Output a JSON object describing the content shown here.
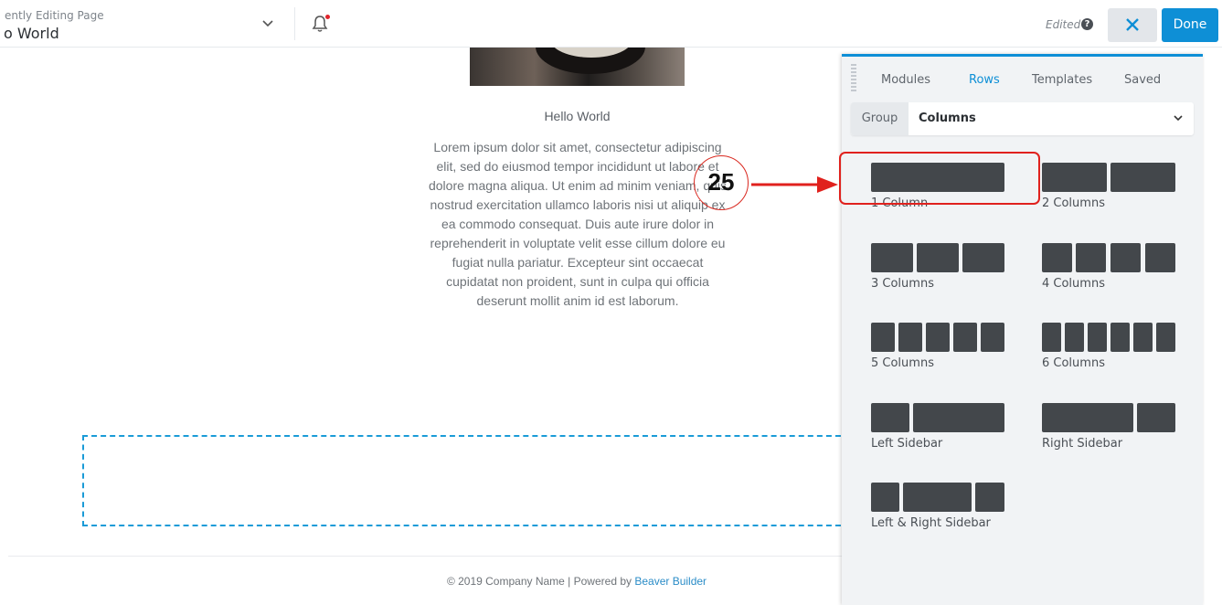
{
  "header": {
    "subtitle": "ently Editing Page",
    "title": "o World",
    "edited_label": "Edited",
    "help_glyph": "?",
    "done_label": "Done",
    "colors": {
      "accent": "#0e8fd6",
      "notification_dot": "#e0242b"
    }
  },
  "content": {
    "heading": "Hello World",
    "body": "Lorem ipsum dolor sit amet, consectetur adipiscing elit, sed do eiusmod tempor incididunt ut labore et dolore magna aliqua. Ut enim ad minim veniam, quis nostrud exercitation ullamco laboris nisi ut aliquip ex ea commodo consequat. Duis aute irure dolor in reprehenderit in voluptate velit esse cillum dolore eu fugiat nulla pariatur. Excepteur sint occaecat cupidatat non proident, sunt in culpa qui officia deserunt mollit anim id est laborum."
  },
  "footer": {
    "text": "© 2019 Company Name | Powered by ",
    "link": "Beaver Builder"
  },
  "annotation": {
    "number": "25",
    "color": "#d9281f"
  },
  "panel": {
    "tabs": [
      {
        "label": "Modules",
        "active": false
      },
      {
        "label": "Rows",
        "active": true
      },
      {
        "label": "Templates",
        "active": false
      },
      {
        "label": "Saved",
        "active": false
      }
    ],
    "group_label": "Group",
    "group_value": "Columns",
    "layouts": [
      {
        "label": "1 Column"
      },
      {
        "label": "2 Columns"
      },
      {
        "label": "3 Columns"
      },
      {
        "label": "4 Columns"
      },
      {
        "label": "5 Columns"
      },
      {
        "label": "6 Columns"
      },
      {
        "label": "Left Sidebar"
      },
      {
        "label": "Right Sidebar"
      },
      {
        "label": "Left & Right Sidebar"
      }
    ]
  }
}
